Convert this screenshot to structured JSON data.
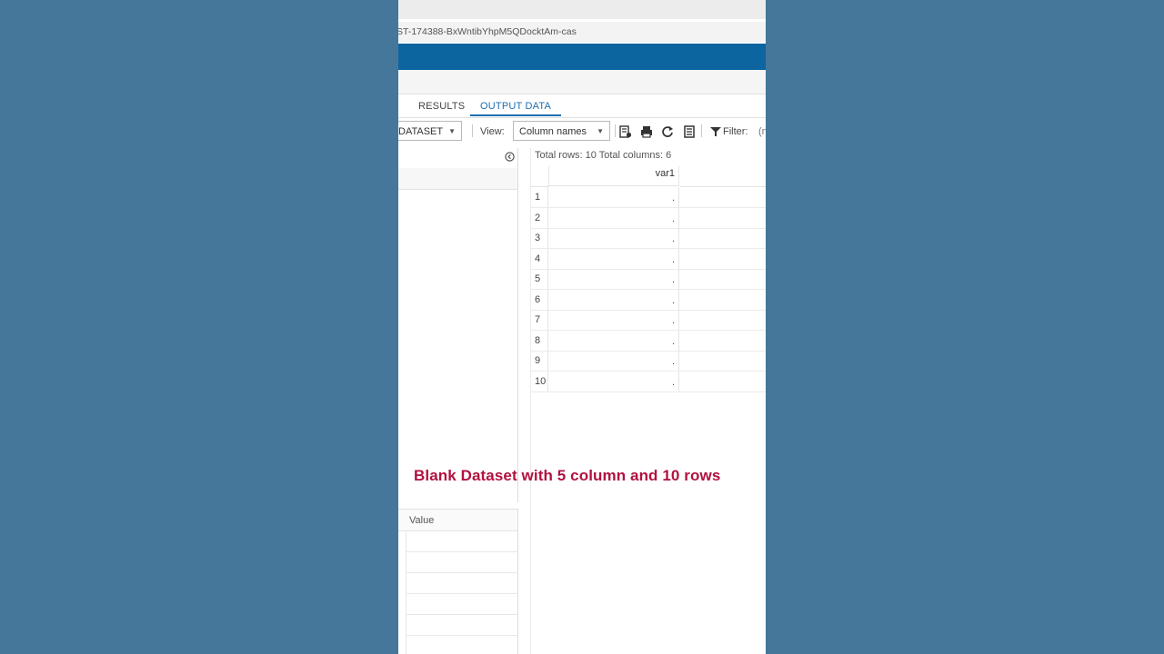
{
  "browser": {
    "url_text": "ST-174388-BxWntibYhpM5QDocktAm-cas"
  },
  "tabs": [
    {
      "label": "RESULTS",
      "active": false
    },
    {
      "label": "OUTPUT DATA",
      "active": true
    }
  ],
  "toolbar": {
    "dataset_value": "DATASET",
    "view_label": "View:",
    "view_value": "Column names",
    "filter_label": "Filter:",
    "filter_extra": "(n",
    "icons": [
      "table-properties-icon",
      "print-icon",
      "refresh-icon",
      "columns-icon",
      "filter-icon"
    ]
  },
  "properties_panel": {
    "value_header": "Value"
  },
  "grid": {
    "totals_text": "Total rows: 10  Total columns: 6",
    "column_header": "var1",
    "rows": [
      {
        "n": "1",
        "v": "."
      },
      {
        "n": "2",
        "v": "."
      },
      {
        "n": "3",
        "v": "."
      },
      {
        "n": "4",
        "v": "."
      },
      {
        "n": "5",
        "v": "."
      },
      {
        "n": "6",
        "v": "."
      },
      {
        "n": "7",
        "v": "."
      },
      {
        "n": "8",
        "v": "."
      },
      {
        "n": "9",
        "v": "."
      },
      {
        "n": "10",
        "v": "."
      }
    ]
  },
  "caption": "Blank Dataset with 5 column and 10 rows",
  "colors": {
    "background": "#45779a",
    "brand_bar": "#0d65a0",
    "active_tab": "#1f6eb0",
    "caption": "#b2113f"
  }
}
